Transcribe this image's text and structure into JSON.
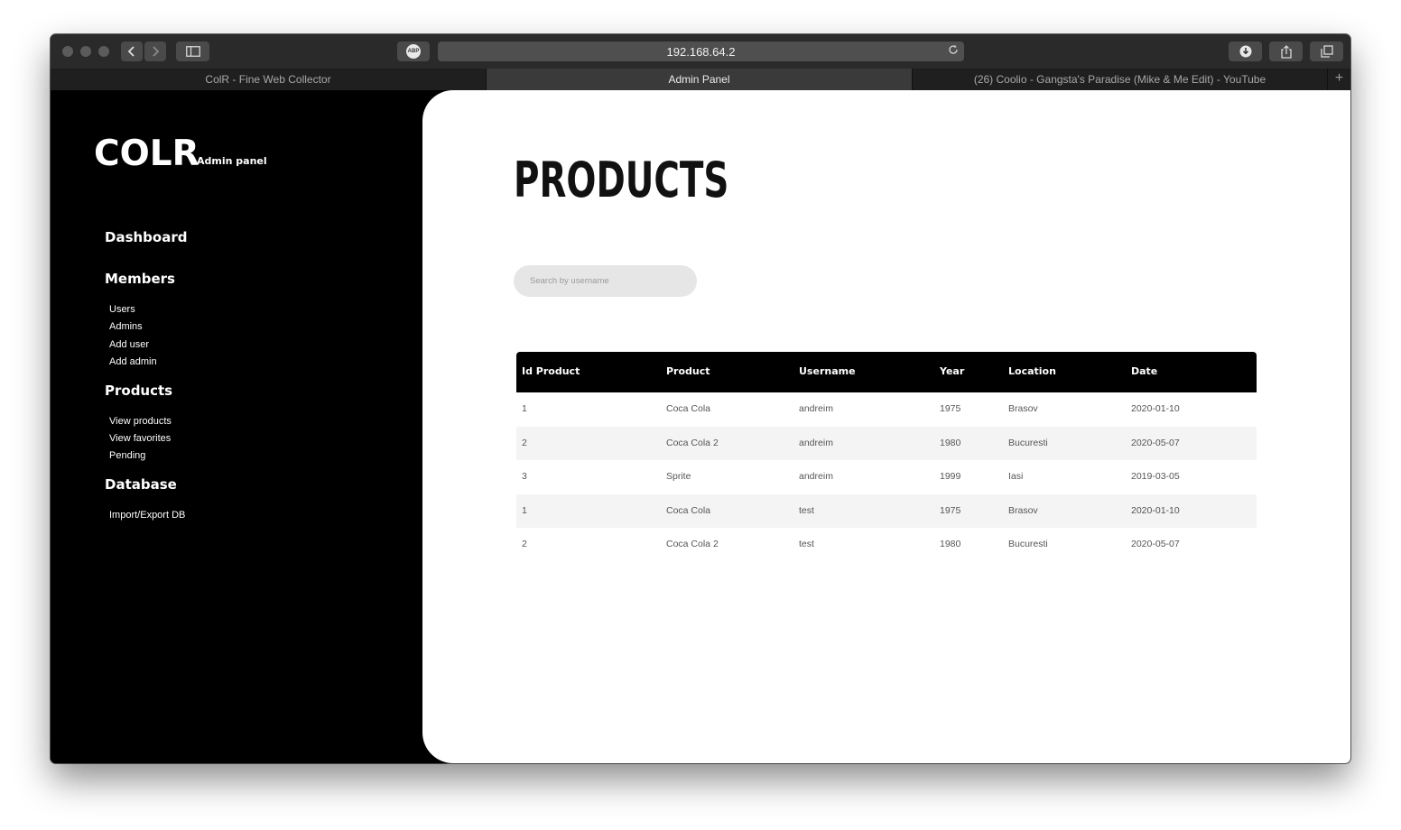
{
  "browser": {
    "url": "192.168.64.2",
    "tabs": [
      {
        "label": "ColR - Fine Web Collector",
        "active": false
      },
      {
        "label": "Admin Panel",
        "active": true
      },
      {
        "label": "(26) Coolio - Gangsta's Paradise (Mike & Me Edit) - YouTube",
        "active": false
      }
    ],
    "abp_label": "ABP"
  },
  "sidebar": {
    "logo": "COLR",
    "logo_sub": "Admin panel",
    "sections": [
      {
        "title": "Dashboard",
        "items": []
      },
      {
        "title": "Members",
        "items": [
          "Users",
          "Admins",
          "Add user",
          "Add admin"
        ]
      },
      {
        "title": "Products",
        "items": [
          "View products",
          "View favorites",
          "Pending"
        ]
      },
      {
        "title": "Database",
        "items": [
          "Import/Export DB"
        ]
      }
    ]
  },
  "main": {
    "title": "PRODUCTS",
    "search_placeholder": "Search by username",
    "table": {
      "headers": [
        "Id Product",
        "Product",
        "Username",
        "Year",
        "Location",
        "Date"
      ],
      "rows": [
        [
          "1",
          "Coca Cola",
          "andreim",
          "1975",
          "Brasov",
          "2020-01-10"
        ],
        [
          "2",
          "Coca Cola 2",
          "andreim",
          "1980",
          "Bucuresti",
          "2020-05-07"
        ],
        [
          "3",
          "Sprite",
          "andreim",
          "1999",
          "Iasi",
          "2019-03-05"
        ],
        [
          "1",
          "Coca Cola",
          "test",
          "1975",
          "Brasov",
          "2020-01-10"
        ],
        [
          "2",
          "Coca Cola 2",
          "test",
          "1980",
          "Bucuresti",
          "2020-05-07"
        ]
      ]
    }
  }
}
